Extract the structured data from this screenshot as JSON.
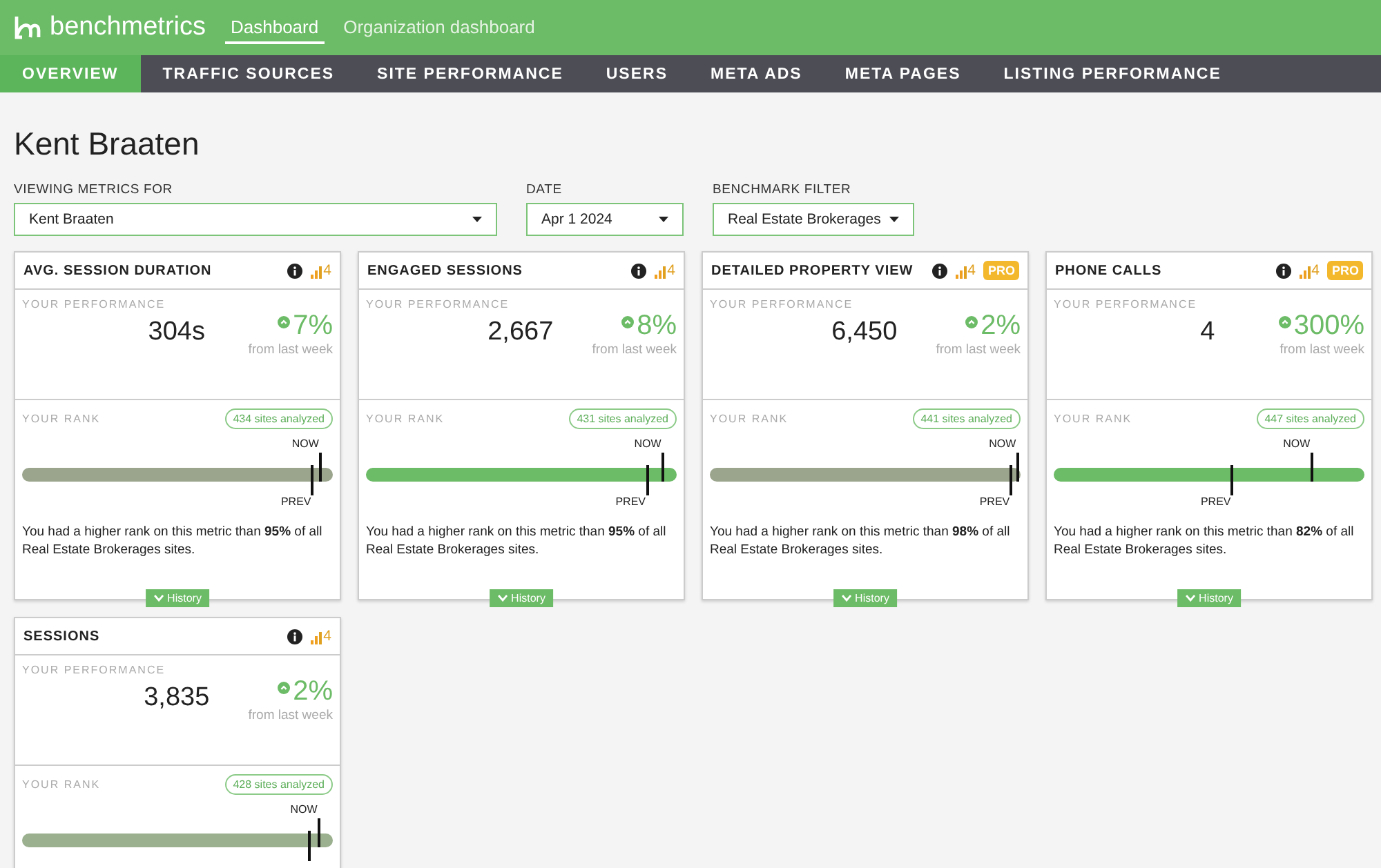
{
  "brand": {
    "name": "benchmetrics"
  },
  "top_nav": [
    {
      "label": "Dashboard",
      "selected": true
    },
    {
      "label": "Organization dashboard",
      "selected": false
    }
  ],
  "tabs": [
    {
      "label": "OVERVIEW",
      "selected": true
    },
    {
      "label": "TRAFFIC SOURCES",
      "selected": false
    },
    {
      "label": "SITE PERFORMANCE",
      "selected": false
    },
    {
      "label": "USERS",
      "selected": false
    },
    {
      "label": "META ADS",
      "selected": false
    },
    {
      "label": "META PAGES",
      "selected": false
    },
    {
      "label": "LISTING PERFORMANCE",
      "selected": false
    }
  ],
  "page_title": "Kent Braaten",
  "filters": [
    {
      "label": "VIEWING METRICS FOR",
      "value": "Kent Braaten",
      "kind": "wide"
    },
    {
      "label": "DATE",
      "value": "Apr 1 2024",
      "kind": "narrow"
    },
    {
      "label": "BENCHMARK FILTER",
      "value": "Real Estate Brokerages",
      "kind": "narrow"
    }
  ],
  "cards": [
    {
      "title": "AVG. SESSION DURATION",
      "signal": "4",
      "performance_label": "YOUR PERFORMANCE",
      "value": "304s",
      "change": "7%",
      "change_note": "from last week",
      "rank_label": "YOUR RANK",
      "sites": "434 sites analyzed",
      "color": "#9ba48c",
      "markers": [
        {
          "label": "NOW",
          "level": 0.955,
          "kind": "now"
        },
        {
          "label": "PREV",
          "level": 0.93,
          "kind": "prev"
        }
      ],
      "summary": "You had a higher rank on this metric than **95%** of all Real Estate Brokerages sites.",
      "history": "History"
    },
    {
      "title": "ENGAGED SESSIONS",
      "signal": "4",
      "performance_label": "YOUR PERFORMANCE",
      "value": "2,667",
      "change": "8%",
      "change_note": "from last week",
      "rank_label": "YOUR RANK",
      "sites": "431 sites analyzed",
      "color": "#6cbb66",
      "markers": [
        {
          "label": "NOW",
          "level": 0.95,
          "kind": "now"
        },
        {
          "label": "PREV",
          "level": 0.9,
          "kind": "prev"
        }
      ],
      "summary": "You had a higher rank on this metric than **95%** of all Real Estate Brokerages sites.",
      "history": "History"
    },
    {
      "title": "DETAILED PROPERTY VIEW",
      "signal": "4",
      "pro": "PRO",
      "performance_label": "YOUR PERFORMANCE",
      "value": "6,450",
      "change": "2%",
      "change_note": "from last week",
      "rank_label": "YOUR RANK",
      "sites": "441 sites analyzed",
      "color": "#9ba48c",
      "markers": [
        {
          "label": "NOW",
          "level": 0.985,
          "kind": "now"
        },
        {
          "label": "PREV",
          "level": 0.965,
          "kind": "prev"
        }
      ],
      "summary": "You had a higher rank on this metric than **98%** of all Real Estate Brokerages sites.",
      "history": "History"
    },
    {
      "title": "PHONE CALLS",
      "signal": "4",
      "pro": "PRO",
      "performance_label": "YOUR PERFORMANCE",
      "value": "4",
      "change": "300%",
      "change_note": "from last week",
      "rank_label": "YOUR RANK",
      "sites": "447 sites analyzed",
      "color": "#6cbb66",
      "markers": [
        {
          "label": "NOW",
          "level": 0.825,
          "kind": "now"
        },
        {
          "label": "PREV",
          "level": 0.57,
          "kind": "prev"
        }
      ],
      "summary": "You had a higher rank on this metric than **82%** of all Real Estate Brokerages sites.",
      "history": "History"
    },
    {
      "title": "SESSIONS",
      "signal": "4",
      "performance_label": "YOUR PERFORMANCE",
      "value": "3,835",
      "change": "2%",
      "change_note": "from last week",
      "rank_label": "YOUR RANK",
      "sites": "428 sites analyzed",
      "color": "#9bb08e",
      "markers": [
        {
          "label": "NOW",
          "level": 0.95,
          "kind": "now"
        },
        {
          "level": 0.92,
          "kind": "prev"
        }
      ]
    }
  ]
}
